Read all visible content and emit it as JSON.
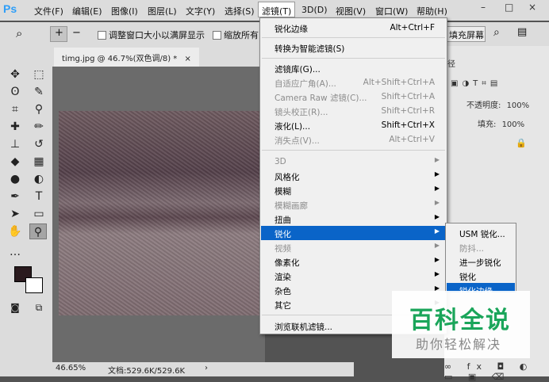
{
  "app": {
    "logo": "Ps"
  },
  "menubar": {
    "items": [
      "文件(F)",
      "编辑(E)",
      "图像(I)",
      "图层(L)",
      "文字(Y)",
      "选择(S)",
      "滤镜(T)",
      "3D(D)",
      "视图(V)",
      "窗口(W)",
      "帮助(H)"
    ],
    "window_controls": [
      "–",
      "□",
      "×"
    ]
  },
  "options_bar": {
    "fit_window_label": "调整窗口大小以满屏显示",
    "zoom_all_label": "缩放所有",
    "fill_screen_label": "填充屏幕"
  },
  "document": {
    "tab_title": "timg.jpg @ 46.7%(双色调/8) *",
    "zoom_status": "46.65%",
    "doc_status": "文档:529.6K/529.6K"
  },
  "filter_menu": {
    "items": [
      {
        "label": "锐化边缘",
        "shortcut": "Alt+Ctrl+F",
        "disabled": false
      },
      {
        "label": "转换为智能滤镜(S)",
        "shortcut": "",
        "disabled": false
      },
      {
        "label": "滤镜库(G)...",
        "shortcut": "",
        "disabled": false
      },
      {
        "label": "自适应广角(A)...",
        "shortcut": "Alt+Shift+Ctrl+A",
        "disabled": true
      },
      {
        "label": "Camera Raw 滤镜(C)...",
        "shortcut": "Shift+Ctrl+A",
        "disabled": true
      },
      {
        "label": "镜头校正(R)...",
        "shortcut": "Shift+Ctrl+R",
        "disabled": true
      },
      {
        "label": "液化(L)...",
        "shortcut": "Shift+Ctrl+X",
        "disabled": false
      },
      {
        "label": "消失点(V)...",
        "shortcut": "Alt+Ctrl+V",
        "disabled": true
      },
      {
        "label": "3D",
        "submenu": true,
        "disabled": true
      },
      {
        "label": "风格化",
        "submenu": true,
        "disabled": false
      },
      {
        "label": "模糊",
        "submenu": true,
        "disabled": false
      },
      {
        "label": "模糊画廊",
        "submenu": true,
        "disabled": true
      },
      {
        "label": "扭曲",
        "submenu": true,
        "disabled": false
      },
      {
        "label": "锐化",
        "submenu": true,
        "disabled": false,
        "highlighted": true
      },
      {
        "label": "视频",
        "submenu": true,
        "disabled": true
      },
      {
        "label": "像素化",
        "submenu": true,
        "disabled": false
      },
      {
        "label": "渲染",
        "submenu": true,
        "disabled": false
      },
      {
        "label": "杂色",
        "submenu": true,
        "disabled": false
      },
      {
        "label": "其它",
        "submenu": true,
        "disabled": false
      },
      {
        "label": "浏览联机滤镜...",
        "shortcut": "",
        "disabled": false
      }
    ]
  },
  "sharpen_submenu": {
    "items": [
      {
        "label": "USM 锐化...",
        "disabled": false
      },
      {
        "label": "防抖...",
        "disabled": true
      },
      {
        "label": "进一步锐化",
        "disabled": false
      },
      {
        "label": "锐化",
        "disabled": false
      },
      {
        "label": "锐化边缘",
        "disabled": false,
        "highlighted": true
      }
    ]
  },
  "layers_panel": {
    "tab_fragment": "径",
    "opacity_label": "不透明度:",
    "opacity_value": "100%",
    "fill_label": "填充:",
    "fill_value": "100%"
  },
  "watermark": {
    "title": "百科全说",
    "subtitle": "助你轻松解决"
  },
  "colors": {
    "highlight": "#0a64c8",
    "watermark_green": "#1aa55a",
    "foreground": "#2a1a1e",
    "background": "#ffffff"
  }
}
